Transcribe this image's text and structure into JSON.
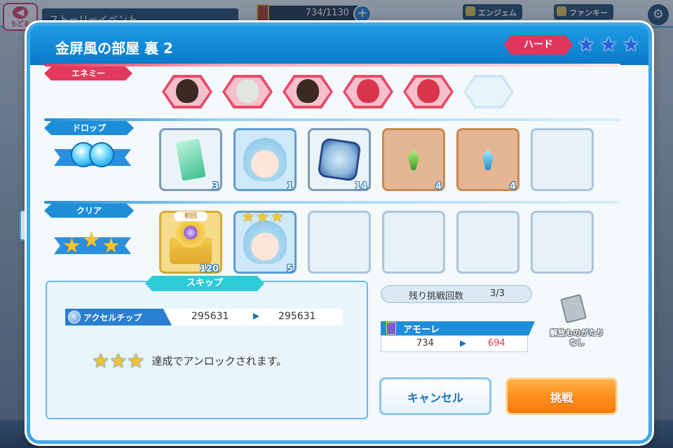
{
  "topbar": {
    "back_label": "もどる",
    "screen_title": "ストーリーイベント",
    "stamina": "734/1130",
    "angem_label": "エンジェム",
    "fankey_label": "ファンキー"
  },
  "dialog": {
    "title": "金屏風の部屋 裏 2",
    "difficulty": "ハード",
    "stars_max": 3
  },
  "sections": {
    "enemy": "エネミー",
    "drop": "ドロップ",
    "clear": "クリア",
    "skip": "スキップ"
  },
  "enemies": [
    {
      "icon": "enemy-samurai-icon",
      "color": "#3a2a22"
    },
    {
      "icon": "enemy-mask-icon",
      "color": "#dfe7e0"
    },
    {
      "icon": "enemy-samurai-icon",
      "color": "#3a2a22"
    },
    {
      "icon": "enemy-fish-icon",
      "color": "#d8344a"
    },
    {
      "icon": "enemy-fish-icon",
      "color": "#d8344a"
    },
    {
      "icon": "",
      "color": ""
    }
  ],
  "drops": [
    {
      "icon": "memory-card-icon",
      "count": "3",
      "style": "filled"
    },
    {
      "icon": "character-portrait-icon",
      "count": "1",
      "style": "blue"
    },
    {
      "icon": "dolphin-plate-icon",
      "count": "14",
      "style": "filled"
    },
    {
      "icon": "green-crystal-icon",
      "count": "4",
      "style": "brown"
    },
    {
      "icon": "blue-crystal-icon",
      "count": "4",
      "style": "brown"
    },
    {
      "icon": "",
      "count": "",
      "style": "empty"
    }
  ],
  "clear_rewards": [
    {
      "icon": "golden-fan-jewel-icon",
      "count": "120",
      "badge": "初回",
      "style": "gold"
    },
    {
      "icon": "character-portrait-icon",
      "count": "5",
      "badge": "",
      "style": "blue",
      "stars": 3
    },
    {
      "icon": "",
      "count": "",
      "badge": "",
      "style": "empty"
    },
    {
      "icon": "",
      "count": "",
      "badge": "",
      "style": "empty"
    },
    {
      "icon": "",
      "count": "",
      "badge": "",
      "style": "empty"
    },
    {
      "icon": "",
      "count": "",
      "badge": "",
      "style": "empty"
    }
  ],
  "skip": {
    "chip_label": "アクセルチップ",
    "chip_from": "295631",
    "chip_to": "295631",
    "unlock_text": "達成でアンロックされます。"
  },
  "info": {
    "remaining_label": "残り挑戦回数",
    "remaining_value": "3/3",
    "amore_label": "アモーレ",
    "amore_from": "734",
    "amore_to": "694",
    "story_label_line1": "解放ものがたり",
    "story_label_line2": "なし"
  },
  "buttons": {
    "cancel": "キャンセル",
    "challenge": "挑戦"
  },
  "colors": {
    "accent": "#1e8ed8",
    "hard": "#e0355c",
    "challenge": "#ff8c1a",
    "cost_after": "#e03a48"
  }
}
